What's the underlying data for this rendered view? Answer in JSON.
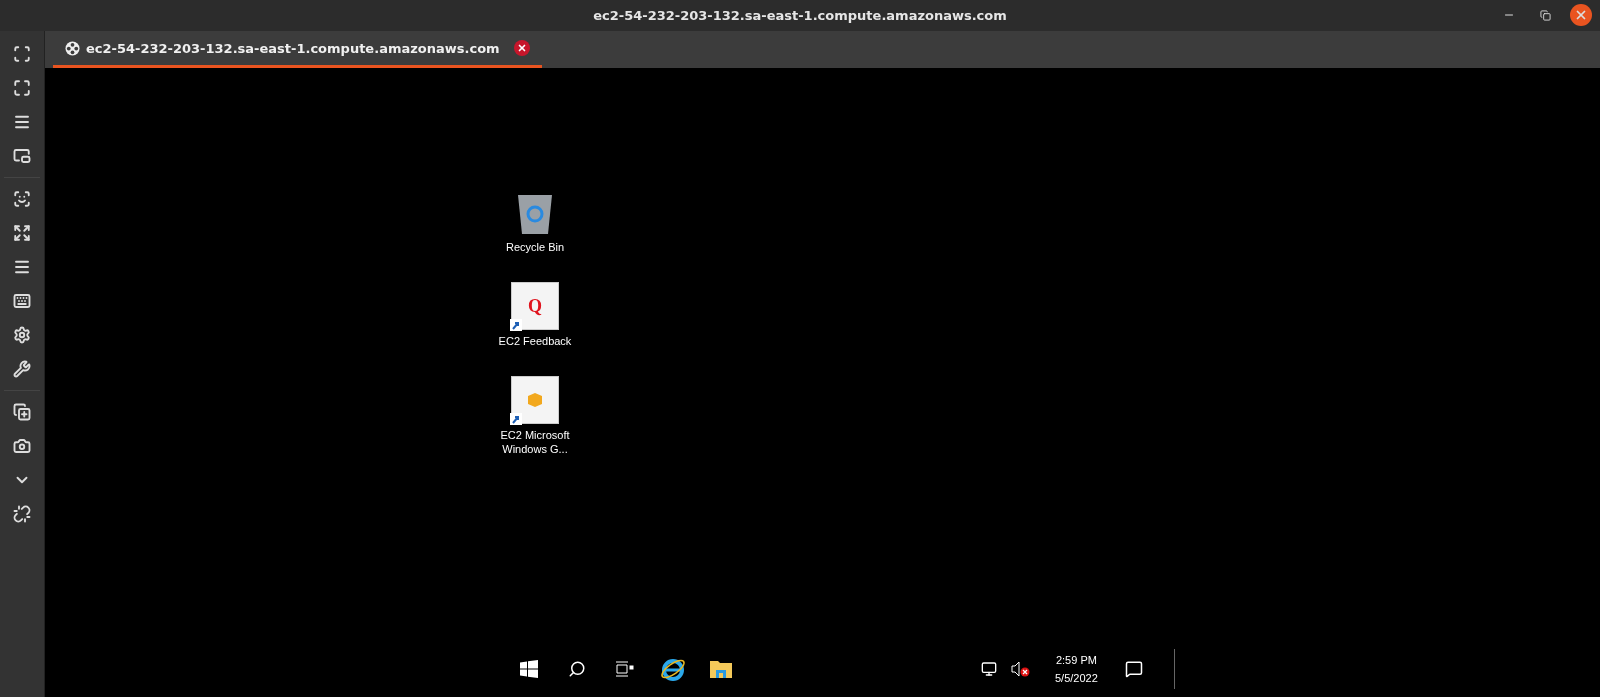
{
  "window": {
    "title": "ec2-54-232-203-132.sa-east-1.compute.amazonaws.com"
  },
  "tabs": [
    {
      "label": "ec2-54-232-203-132.sa-east-1.compute.amazonaws.com",
      "selected": true
    }
  ],
  "desktop_icons": [
    {
      "label": "Recycle Bin",
      "kind": "recycle"
    },
    {
      "label": "EC2 Feedback",
      "kind": "feedback",
      "glyph": "Q"
    },
    {
      "label": "EC2 Microsoft Windows G...",
      "kind": "package"
    }
  ],
  "taskbar": {
    "time": "2:59 PM",
    "date": "5/5/2022"
  }
}
